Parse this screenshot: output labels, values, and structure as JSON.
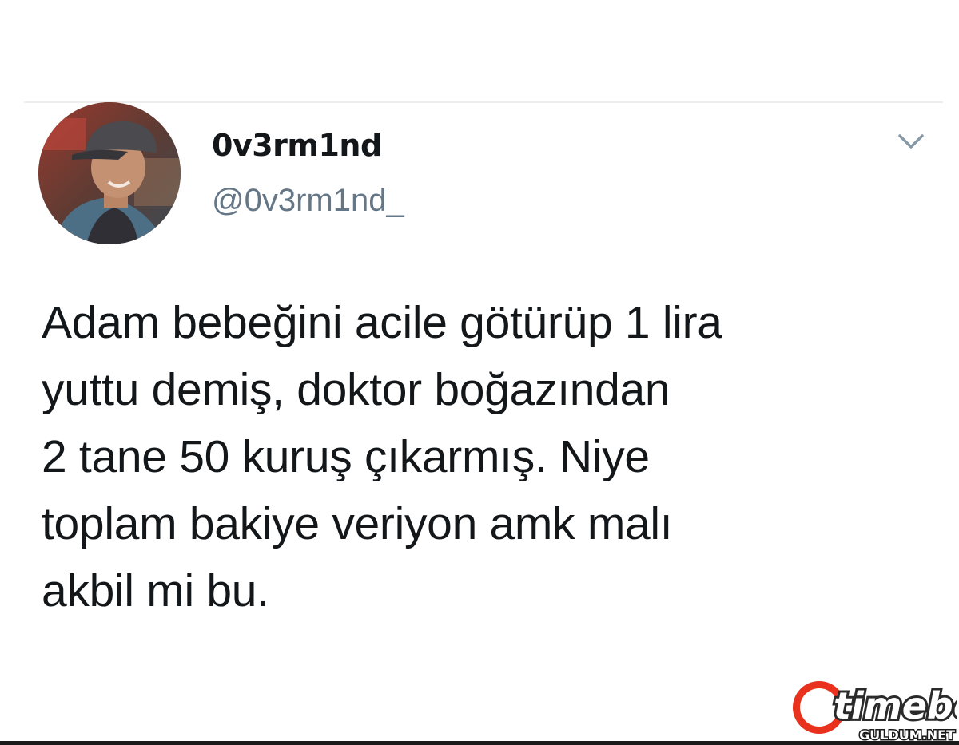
{
  "tweet": {
    "author": {
      "display_name": "0v3rm1nd",
      "handle": "@0v3rm1nd_",
      "avatar_icon": "user-avatar-photo"
    },
    "menu_icon": "chevron-down-icon",
    "text_lines": [
      "Adam bebeğini acile götürüp 1 lira",
      "yuttu demiş, doktor boğazından",
      "2 tane 50 kuruş çıkarmış. Niye",
      "toplam bakiye veriyon amk malı",
      "akbil mi bu."
    ]
  },
  "watermark": {
    "brand": "timebet",
    "site": "GULDUM.NET",
    "brand_color": "#e8321e",
    "text_color": "#ffffff"
  },
  "colors": {
    "text_primary": "#14171a",
    "text_secondary": "#657786",
    "divider": "#eeeeee"
  }
}
